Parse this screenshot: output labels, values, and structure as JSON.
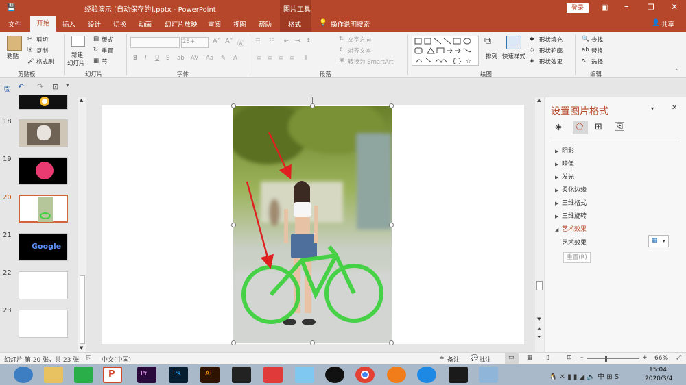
{
  "window": {
    "title": "经验演示 [自动保存的].pptx - PowerPoint",
    "context_tool": "图片工具",
    "login": "登录",
    "share": "共享"
  },
  "tabs": [
    "文件",
    "开始",
    "插入",
    "设计",
    "切换",
    "动画",
    "幻灯片放映",
    "审阅",
    "视图",
    "帮助",
    "格式"
  ],
  "active_tab": "开始",
  "tell_me": "操作说明搜索",
  "ribbon": {
    "clipboard": {
      "label": "剪贴板",
      "paste": "粘贴",
      "cut": "剪切",
      "copy": "复制",
      "format_painter": "格式刷"
    },
    "slides": {
      "label": "幻灯片",
      "new_slide": "新建",
      "new_slide2": "幻灯片",
      "layout": "版式",
      "reset": "重置",
      "section": "节"
    },
    "font": {
      "label": "字体",
      "size": "28+"
    },
    "paragraph": {
      "label": "段落",
      "text_direction": "文字方向",
      "align_text": "对齐文本",
      "smartart": "转换为 SmartArt"
    },
    "drawing": {
      "label": "绘图",
      "arrange": "排列",
      "quick_styles": "快速样式",
      "fill": "形状填充",
      "outline": "形状轮廓",
      "effects": "形状效果"
    },
    "editing": {
      "label": "编辑",
      "find": "查找",
      "replace": "替换",
      "select": "选择"
    }
  },
  "slide_numbers": [
    "18",
    "19",
    "20",
    "21",
    "22",
    "23"
  ],
  "selected_slide": "20",
  "thumb21_text": "Google",
  "pane": {
    "title": "设置图片格式",
    "items": [
      "阴影",
      "映像",
      "发光",
      "柔化边缘",
      "三维格式",
      "三维旋转",
      "艺术效果"
    ],
    "sub_label": "艺术效果",
    "reset_button": "重置(R)"
  },
  "status": {
    "slide_info": "幻灯片 第 20 张，共 23 张",
    "language": "中文(中国)",
    "notes": "备注",
    "comments": "批注",
    "zoom": "66%"
  },
  "taskbar": {
    "time": "15:04",
    "date": "2020/3/4",
    "apps": [
      "Pr",
      "Ps",
      "Ai"
    ]
  },
  "colors": {
    "accent": "#b7472a",
    "arrow": "#e02020",
    "bike": "#3fd13f"
  }
}
